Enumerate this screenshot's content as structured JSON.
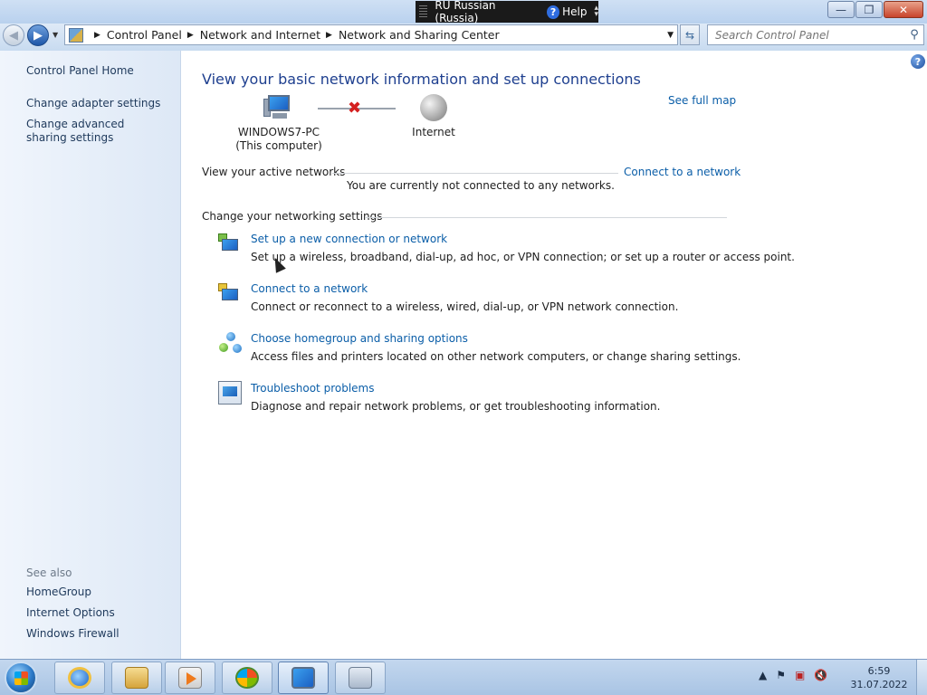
{
  "window": {
    "language_indicator": "RU Russian (Russia)",
    "help_label": "Help",
    "min_symbol": "—",
    "max_symbol": "❐",
    "close_symbol": "✕"
  },
  "navbar": {
    "breadcrumb": [
      "Control Panel",
      "Network and Internet",
      "Network and Sharing Center"
    ],
    "search_placeholder": "Search Control Panel"
  },
  "sidebar": {
    "home": "Control Panel Home",
    "links": [
      "Change adapter settings",
      "Change advanced sharing settings"
    ],
    "see_also_label": "See also",
    "see_also": [
      "HomeGroup",
      "Internet Options",
      "Windows Firewall"
    ]
  },
  "main": {
    "heading": "View your basic network information and set up connections",
    "see_full_map": "See full map",
    "computer_name": "WINDOWS7-PC",
    "computer_sub": "(This computer)",
    "internet_label": "Internet",
    "active_networks_label": "View your active networks",
    "connect_link": "Connect to a network",
    "not_connected": "You are currently not connected to any networks.",
    "change_settings_label": "Change your networking settings",
    "tasks": [
      {
        "title": "Set up a new connection or network",
        "description": "Set up a wireless, broadband, dial-up, ad hoc, or VPN connection; or set up a router or access point.",
        "icon": "new-connection-icon"
      },
      {
        "title": "Connect to a network",
        "description": "Connect or reconnect to a wireless, wired, dial-up, or VPN network connection.",
        "icon": "connect-network-icon"
      },
      {
        "title": "Choose homegroup and sharing options",
        "description": "Access files and printers located on other network computers, or change sharing settings.",
        "icon": "homegroup-icon"
      },
      {
        "title": "Troubleshoot problems",
        "description": "Diagnose and repair network problems, or get troubleshooting information.",
        "icon": "troubleshoot-icon"
      }
    ]
  },
  "taskbar": {
    "time": "6:59",
    "date": "31.07.2022",
    "pinned": [
      "internet-explorer-icon",
      "windows-explorer-icon",
      "media-player-icon",
      "windows7-icon",
      "network-center-icon",
      "control-panel-icon"
    ]
  },
  "colors": {
    "link": "#0b5ea8",
    "heading": "#1e3f8f",
    "sidebar_link": "#1e395b"
  }
}
